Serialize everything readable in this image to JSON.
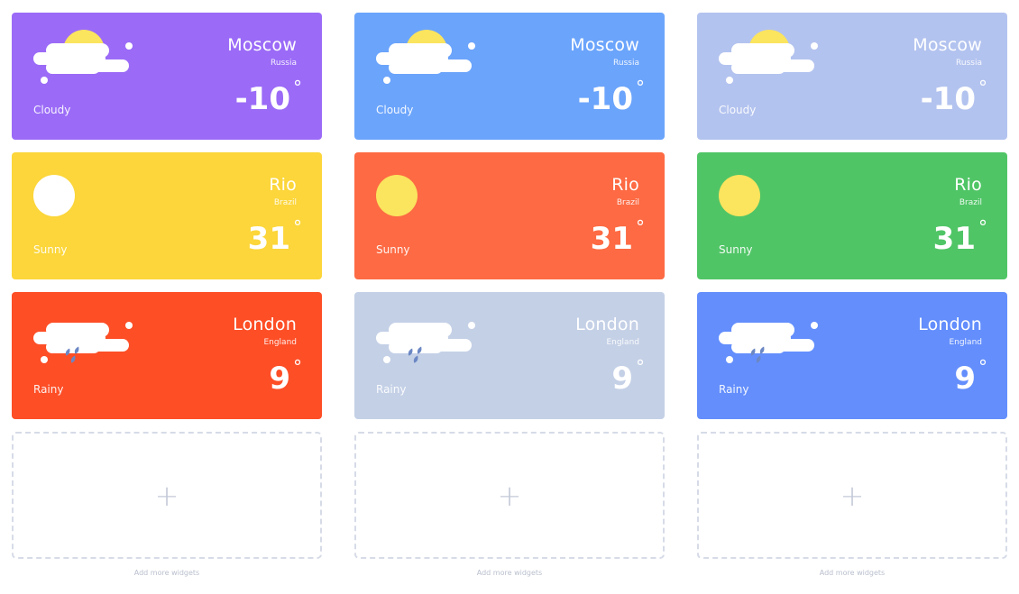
{
  "columns": [
    {
      "cards": [
        {
          "city": "Moscow",
          "country": "Russia",
          "condition": "Cloudy",
          "temp": "-10",
          "icon": "cloudy-sun-icon",
          "bg": "#9b6bf7"
        },
        {
          "city": "Rio",
          "country": "Brazil",
          "condition": "Sunny",
          "temp": "31",
          "icon": "sun-icon",
          "bg": "#fcd63a"
        },
        {
          "city": "London",
          "country": "England",
          "condition": "Rainy",
          "temp": "9",
          "icon": "rain-cloud-icon",
          "bg": "#fd4e26"
        }
      ],
      "add": {
        "plus": "+",
        "caption": "Add more widgets"
      }
    },
    {
      "cards": [
        {
          "city": "Moscow",
          "country": "Russia",
          "condition": "Cloudy",
          "temp": "-10",
          "icon": "cloudy-sun-icon",
          "bg": "#6ba4fb"
        },
        {
          "city": "Rio",
          "country": "Brazil",
          "condition": "Sunny",
          "temp": "31",
          "icon": "sun-icon",
          "bg": "#fd6a43"
        },
        {
          "city": "London",
          "country": "England",
          "condition": "Rainy",
          "temp": "9",
          "icon": "rain-cloud-icon",
          "bg": "#c4d0e6"
        }
      ],
      "add": {
        "plus": "+",
        "caption": "Add more widgets"
      }
    },
    {
      "cards": [
        {
          "city": "Moscow",
          "country": "Russia",
          "condition": "Cloudy",
          "temp": "-10",
          "icon": "cloudy-sun-icon",
          "bg": "#b3c3ef"
        },
        {
          "city": "Rio",
          "country": "Brazil",
          "condition": "Sunny",
          "temp": "31",
          "icon": "sun-icon",
          "bg": "#50c566"
        },
        {
          "city": "London",
          "country": "England",
          "condition": "Rainy",
          "temp": "9",
          "icon": "rain-cloud-icon",
          "bg": "#638efc"
        }
      ],
      "add": {
        "plus": "+",
        "caption": "Add more widgets"
      }
    }
  ],
  "colors": {
    "sun": "#fbe45e",
    "cloud": "#ffffff",
    "drop": "#6b87c4",
    "sunny_disc_white": "#ffffff"
  }
}
